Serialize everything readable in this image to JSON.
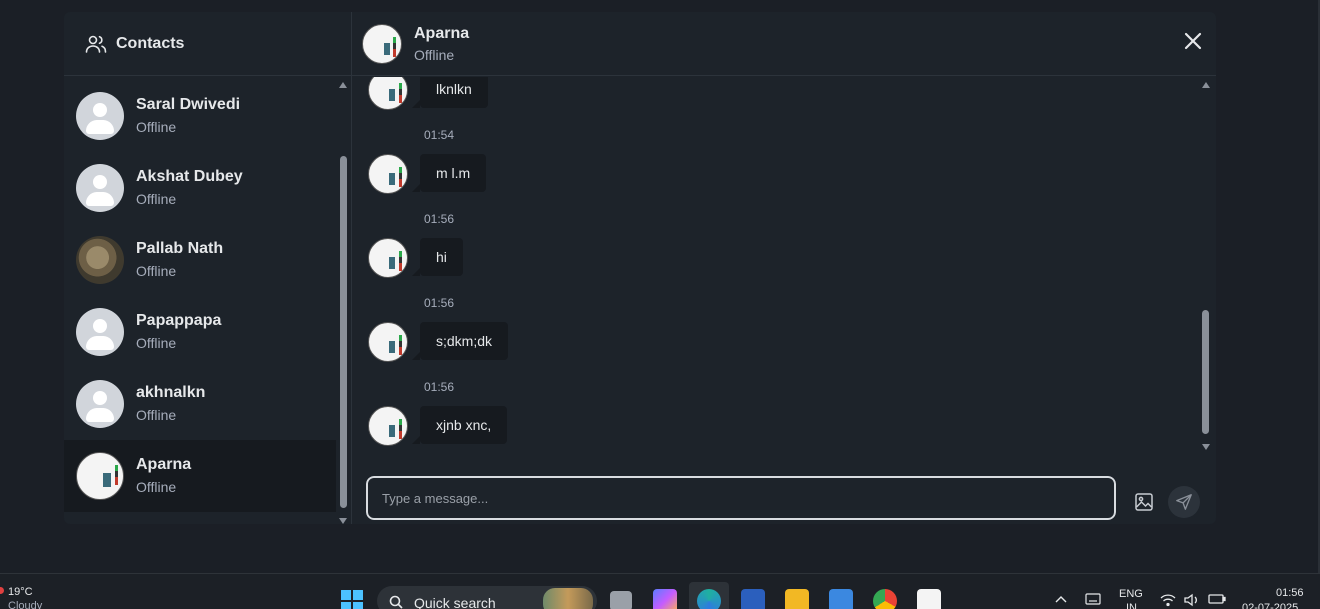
{
  "sidebar": {
    "title": "Contacts",
    "contacts": [
      {
        "name": "Saral Dwivedi",
        "status": "Offline",
        "avatar": "default"
      },
      {
        "name": "Akshat Dubey",
        "status": "Offline",
        "avatar": "default"
      },
      {
        "name": "Pallab Nath",
        "status": "Offline",
        "avatar": "photo"
      },
      {
        "name": "Papappapa",
        "status": "Offline",
        "avatar": "default"
      },
      {
        "name": "akhnalkn",
        "status": "Offline",
        "avatar": "default"
      },
      {
        "name": "Aparna",
        "status": "Offline",
        "avatar": "screen",
        "active": true
      }
    ]
  },
  "chat": {
    "name": "Aparna",
    "status": "Offline",
    "messages": [
      {
        "time": "",
        "text": "lknlkn"
      },
      {
        "time": "01:54",
        "text": "m l.m"
      },
      {
        "time": "01:56",
        "text": "hi"
      },
      {
        "time": "01:56",
        "text": "s;dkm;dk"
      },
      {
        "time": "01:56",
        "text": "xjnb xnc,"
      }
    ],
    "input_placeholder": "Type a message..."
  },
  "taskbar": {
    "weather_temp": "19°C",
    "weather_cond": "Cloudy",
    "search_label": "Quick search",
    "lang_top": "ENG",
    "lang_bottom": "IN",
    "time": "01:56",
    "date": "02-07-2025"
  },
  "colors": {
    "background": "#1b1f26",
    "panel": "#1d232a",
    "bubble": "#161a1f",
    "muted_text": "#a6adbb"
  }
}
